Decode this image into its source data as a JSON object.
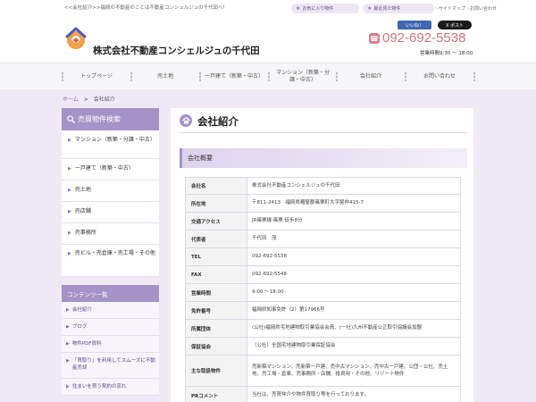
{
  "top": {
    "tagline": "<<会社紹介>>福岡の不動産のことは不動産コンシェルジュの千代田へ!",
    "favorites_label": "お気に入り物件",
    "recent_label": "最近見た物件",
    "sitemap_label": "サイトマップ",
    "inquiry_label": "お問い合わせ"
  },
  "header": {
    "company_name": "株式会社不動産コンシェルジュの千代田",
    "fb_label": "いいね！",
    "x_label": "X ポスト",
    "phone": "092-692-5538",
    "hours": "営業時間9:30 ～ 18:00"
  },
  "nav": {
    "items": [
      {
        "label": "トップページ"
      },
      {
        "label": "売土地"
      },
      {
        "label": "一戸建て（新築・中古）"
      },
      {
        "label": "マンション（新築・分譲・中古）"
      },
      {
        "label": "会社紹介"
      },
      {
        "label": "お問い合わせ"
      }
    ]
  },
  "breadcrumb": {
    "home": "ホーム",
    "separator": ">",
    "current": "会社紹介"
  },
  "sidebar": {
    "search_title": "売買物件検索",
    "items": [
      {
        "label": "マンション（新築・分譲・中古）"
      },
      {
        "label": "一戸建て（新築・中古）"
      },
      {
        "label": "売土地"
      },
      {
        "label": "売店舗"
      },
      {
        "label": "売事務所"
      },
      {
        "label": "売ビル・売倉庫・売工場・その他"
      }
    ],
    "contents_title": "コンテンツ一覧",
    "contents": [
      {
        "label": "会社紹介"
      },
      {
        "label": "ブログ"
      },
      {
        "label": "物件PDF資料"
      },
      {
        "label": "「買取り」を利用してスムーズに不動産売却"
      },
      {
        "label": "住まいを買う契約の流れ"
      }
    ]
  },
  "main": {
    "title": "会社紹介",
    "section_title": "会社概要",
    "rows": [
      {
        "label": "会社名",
        "value": "株式会社不動産コンシェルジュの千代田"
      },
      {
        "label": "所在地",
        "value": "〒811-2413　福岡県糟屋郡篠栗町大字尾仲415-7"
      },
      {
        "label": "交通アクセス",
        "value": "JR篠栗線 篠栗 徒歩8分"
      },
      {
        "label": "代表者",
        "value": "千代田　茂"
      },
      {
        "label": "TEL",
        "value": "092-692-5538"
      },
      {
        "label": "FAX",
        "value": "092-692-5548"
      },
      {
        "label": "営業時間",
        "value": "9:00 ～18:00"
      },
      {
        "label": "免許番号",
        "value": "福岡県知事免許（2）第17966号"
      },
      {
        "label": "所属団体",
        "value": "(公社)福岡県宅地建物取引業協会会員、(一社)九州不動産公正取引協議会加盟"
      },
      {
        "label": "保証協会",
        "value": "（公社）全国宅地建物取引業保証協会"
      },
      {
        "label": "主な取扱物件",
        "value": "売新築マンション、売新築一戸建、売中古マンション、売中古一戸建、公団・公社、売土地、売工場・倉庫、売事務所・店舗、投資用・その他、リゾート物件"
      },
      {
        "label": "PRコメント",
        "value": "当社は、売買仲介や物件買取り等を行っております。"
      }
    ]
  },
  "colors": {
    "accent": "#a493c9",
    "phone": "#d4727d",
    "band": "#efe9f6"
  }
}
